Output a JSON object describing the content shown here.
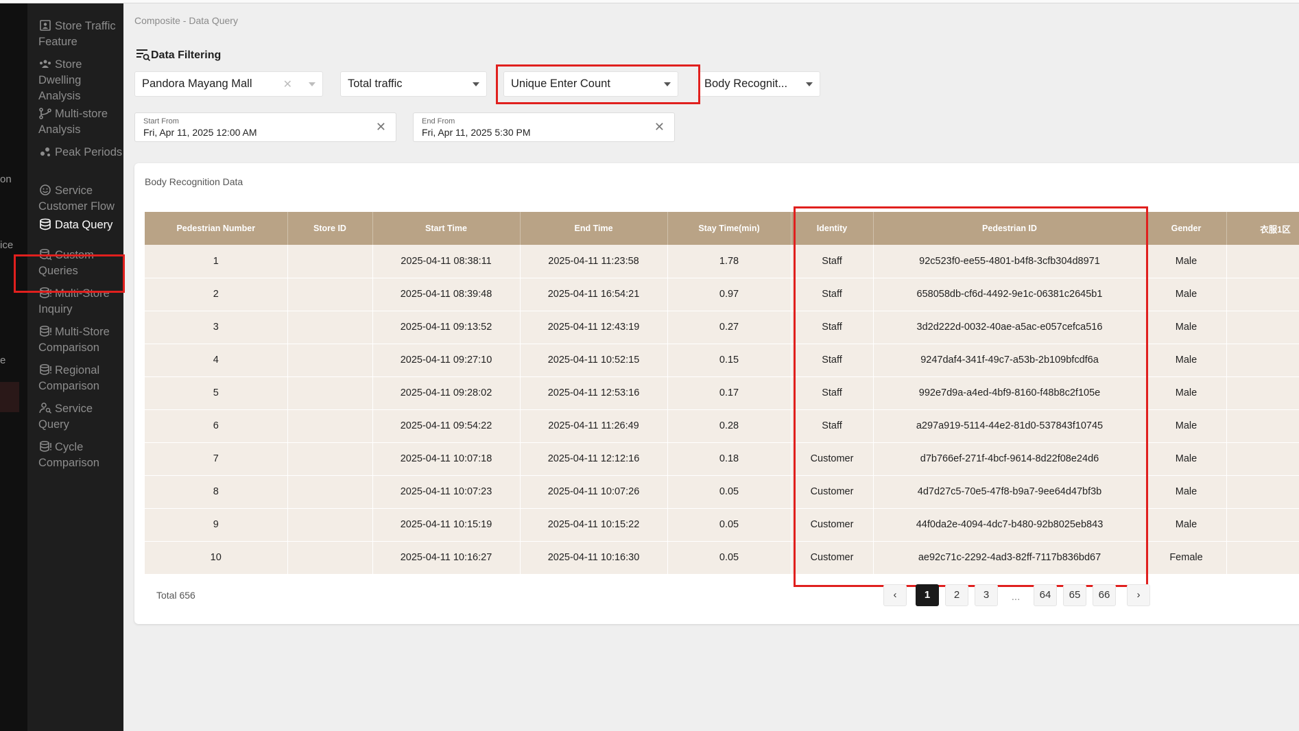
{
  "rail": {
    "fragments": [
      "on",
      "ice",
      "e"
    ]
  },
  "sidebar": {
    "items": [
      {
        "label": "Store Traffic Feature",
        "icon": "person-board-icon"
      },
      {
        "label": "Store Dwelling Analysis",
        "icon": "people-group-icon"
      },
      {
        "label": "Multi-store Analysis",
        "icon": "branch-icon"
      },
      {
        "label": "Peak Periods",
        "icon": "scatter-dots-icon"
      },
      {
        "label": "Service Customer Flow",
        "icon": "smile-face-icon"
      },
      {
        "label": "Data Query",
        "icon": "database-icon",
        "active": true
      },
      {
        "label": "Custom Queries",
        "icon": "database-search-icon"
      },
      {
        "label": "Multi-Store Inquiry",
        "icon": "database-alert-icon"
      },
      {
        "label": "Multi-Store Comparison",
        "icon": "database-alert-icon"
      },
      {
        "label": "Regional Comparison",
        "icon": "database-alert-icon"
      },
      {
        "label": "Service Query",
        "icon": "person-search-icon"
      },
      {
        "label": "Cycle Comparison",
        "icon": "database-alert-icon"
      }
    ]
  },
  "breadcrumb": "Composite - Data Query",
  "filtering": {
    "title": "Data Filtering",
    "mall": "Pandora Mayang Mall",
    "traffic": "Total traffic",
    "metric": "Unique Enter Count",
    "recognition": "Body Recognit...",
    "start": {
      "caption": "Start From",
      "value": "Fri, Apr 11, 2025 12:00 AM"
    },
    "end": {
      "caption": "End From",
      "value": "Fri, Apr 11, 2025 5:30 PM"
    }
  },
  "table": {
    "title": "Body Recognition Data",
    "headers": [
      "Pedestrian Number",
      "Store ID",
      "Start Time",
      "End Time",
      "Stay Time(min)",
      "Identity",
      "Pedestrian ID",
      "Gender",
      "衣服1区"
    ],
    "rows": [
      [
        "1",
        "",
        "2025-04-11 08:38:11",
        "2025-04-11 11:23:58",
        "1.78",
        "Staff",
        "92c523f0-ee55-4801-b4f8-3cfb304d8971",
        "Male",
        ""
      ],
      [
        "2",
        "",
        "2025-04-11 08:39:48",
        "2025-04-11 16:54:21",
        "0.97",
        "Staff",
        "658058db-cf6d-4492-9e1c-06381c2645b1",
        "Male",
        ""
      ],
      [
        "3",
        "",
        "2025-04-11 09:13:52",
        "2025-04-11 12:43:19",
        "0.27",
        "Staff",
        "3d2d222d-0032-40ae-a5ac-e057cefca516",
        "Male",
        ""
      ],
      [
        "4",
        "",
        "2025-04-11 09:27:10",
        "2025-04-11 10:52:15",
        "0.15",
        "Staff",
        "9247daf4-341f-49c7-a53b-2b109bfcdf6a",
        "Male",
        ""
      ],
      [
        "5",
        "",
        "2025-04-11 09:28:02",
        "2025-04-11 12:53:16",
        "0.17",
        "Staff",
        "992e7d9a-a4ed-4bf9-8160-f48b8c2f105e",
        "Male",
        ""
      ],
      [
        "6",
        "",
        "2025-04-11 09:54:22",
        "2025-04-11 11:26:49",
        "0.28",
        "Staff",
        "a297a919-5114-44e2-81d0-537843f10745",
        "Male",
        ""
      ],
      [
        "7",
        "",
        "2025-04-11 10:07:18",
        "2025-04-11 12:12:16",
        "0.18",
        "Customer",
        "d7b766ef-271f-4bcf-9614-8d22f08e24d6",
        "Male",
        ""
      ],
      [
        "8",
        "",
        "2025-04-11 10:07:23",
        "2025-04-11 10:07:26",
        "0.05",
        "Customer",
        "4d7d27c5-70e5-47f8-b9a7-9ee64d47bf3b",
        "Male",
        ""
      ],
      [
        "9",
        "",
        "2025-04-11 10:15:19",
        "2025-04-11 10:15:22",
        "0.05",
        "Customer",
        "44f0da2e-4094-4dc7-b480-92b8025eb843",
        "Male",
        ""
      ],
      [
        "10",
        "",
        "2025-04-11 10:16:27",
        "2025-04-11 10:16:30",
        "0.05",
        "Customer",
        "ae92c71c-2292-4ad3-82ff-7117b836bd67",
        "Female",
        ""
      ]
    ],
    "total": "Total 656"
  },
  "pagination": {
    "prev": "‹",
    "next": "›",
    "pages": [
      "1",
      "2",
      "3",
      "...",
      "64",
      "65",
      "66"
    ],
    "current": "1"
  },
  "colors": {
    "highlight": "#e0201e",
    "header_bg": "#b9a386",
    "row_bg": "#f3ede6",
    "sidebar_bg": "#1e1e1e"
  }
}
